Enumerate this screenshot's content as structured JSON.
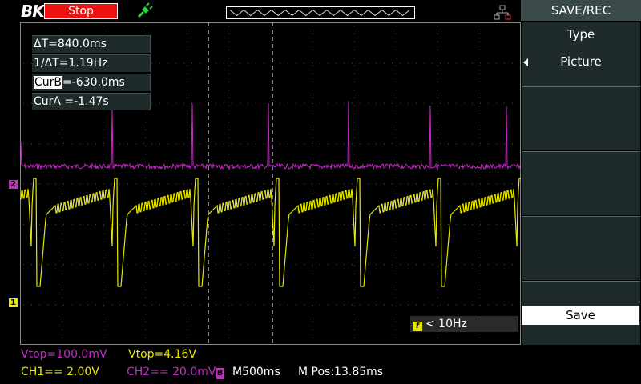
{
  "header": {
    "logo": "BK",
    "run_state": "Stop",
    "trigger_icon": "trigger-plug-icon",
    "network_icon": "network-icon"
  },
  "readouts": {
    "delta_t": "ΔT=840.0ms",
    "inv_delta_t": "1/ΔT=1.19Hz",
    "cur_b_label": "CurB",
    "cur_b_value": "=-630.0ms",
    "cur_a": "CurA =-1.47s"
  },
  "channel_markers": {
    "ch1": "1",
    "ch2": "2"
  },
  "frequency": {
    "icon": "f",
    "value": "< 10Hz"
  },
  "status": {
    "ch2_vtop": "Vtop=100.0mV",
    "ch1_vtop": "Vtop=4.16V",
    "ch1_scale": "CH1== 2.00V",
    "ch2_scale": "CH2== 20.0mV",
    "ch2_badge": "B",
    "timebase": "M500ms",
    "mpos": "M Pos:13.85ms"
  },
  "menu": {
    "title": "SAVE/REC",
    "items": [
      {
        "label": "Type"
      },
      {
        "label": "Picture"
      },
      {
        "label": ""
      },
      {
        "label": ""
      },
      {
        "label": ""
      },
      {
        "label": "Save"
      }
    ]
  },
  "colors": {
    "ch1": "#e8e800",
    "ch2": "#c82ac8",
    "stop": "#ee1111",
    "menu_bg": "#1f2a2a"
  }
}
